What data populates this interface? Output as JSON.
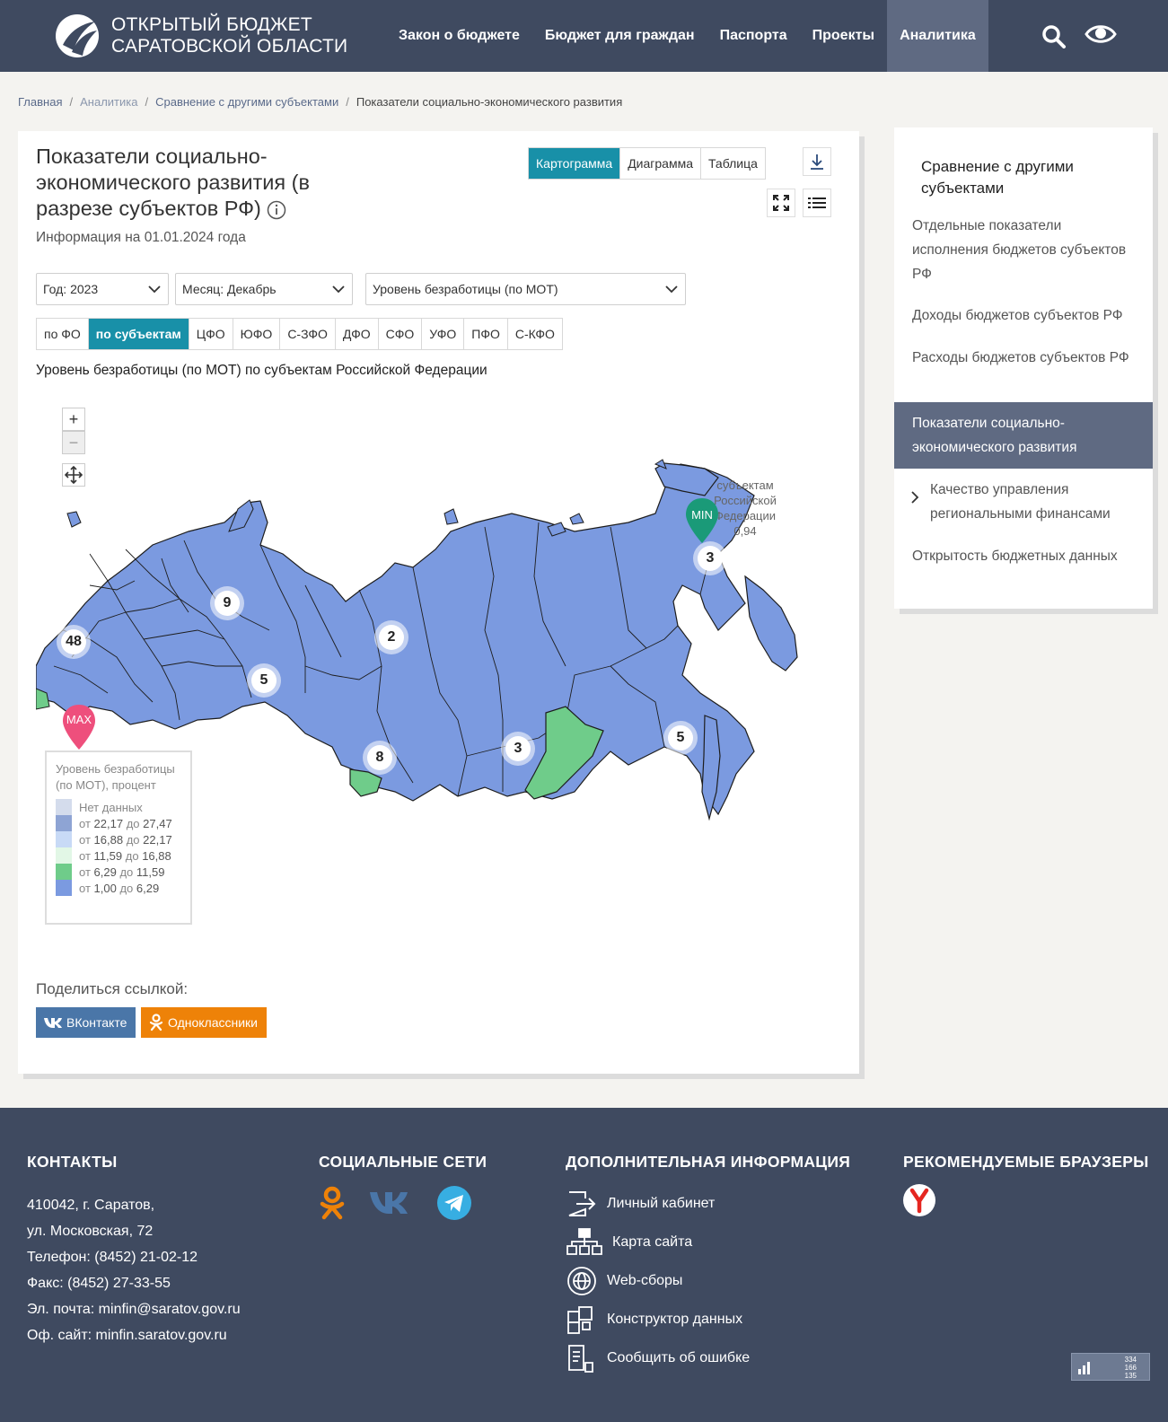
{
  "header": {
    "logo_line1": "ОТКРЫТЫЙ БЮДЖЕТ",
    "logo_line2": "САРАТОВСКОЙ ОБЛАСТИ",
    "nav": [
      {
        "label": "Закон о бюджете"
      },
      {
        "label": "Бюджет для граждан"
      },
      {
        "label": "Паспорта"
      },
      {
        "label": "Проекты"
      },
      {
        "label": "Аналитика"
      }
    ]
  },
  "breadcrumb": {
    "home": "Главная",
    "analytics": "Аналитика",
    "compare": "Сравнение с другими субъектами",
    "current": "Показатели социально-экономического развития"
  },
  "card": {
    "title": "Показатели социально-экономического развития (в разрезе субъектов РФ)",
    "subtitle": "Информация на 01.01.2024 года",
    "view_tabs": [
      "Картограмма",
      "Диаграмма",
      "Таблица"
    ],
    "selects": {
      "year": "Год: 2023",
      "month": "Месяц: Декабрь",
      "indicator": "Уровень безработицы (по МОТ)"
    },
    "region_tabs": [
      "по ФО",
      "по субъектам",
      "ЦФО",
      "ЮФО",
      "С-ЗФО",
      "ДФО",
      "СФО",
      "УФО",
      "ПФО",
      "С-КФО"
    ],
    "map_title": "Уровень безработицы (по МОТ) по субъектам Российской Федерации",
    "zoom_in": "+",
    "zoom_out": "−",
    "clusters": [
      "9",
      "48",
      "2",
      "5",
      "8",
      "3",
      "3",
      "5"
    ],
    "min_label": "MIN",
    "max_label": "MAX",
    "min_tooltip": [
      "субъектам",
      "Российской",
      "Федерации",
      "0,94"
    ],
    "legend": {
      "title": "Уровень безработицы (по МОТ), процент",
      "no_data": "Нет данных",
      "from_word": "от",
      "to_word": "до",
      "ranges": [
        {
          "from": "22,17",
          "to": "27,47"
        },
        {
          "from": "16,88",
          "to": "22,17"
        },
        {
          "from": "11,59",
          "to": "16,88"
        },
        {
          "from": "6,29",
          "to": "11,59"
        },
        {
          "from": "1,00",
          "to": "6,29"
        }
      ]
    },
    "share_label": "Поделиться ссылкой:",
    "share_vk": "ВКонтакте",
    "share_ok": "Одноклассники"
  },
  "sidebar": {
    "title": "Сравнение с другими субъектами",
    "items": [
      {
        "label": "Отдельные показатели исполнения бюджетов субъектов РФ"
      },
      {
        "label": "Доходы бюджетов субъектов РФ"
      },
      {
        "label": "Расходы бюджетов субъектов РФ"
      },
      {
        "label": "Показатели социально-экономического развития"
      },
      {
        "label": "Качество управления региональными финансами"
      },
      {
        "label": "Открытость бюджетных данных"
      }
    ]
  },
  "footer": {
    "contacts_title": "КОНТАКТЫ",
    "contacts": [
      "410042, г. Саратов,",
      "ул. Московская, 72",
      "Телефон: (8452) 21-02-12",
      "Факс: (8452) 27-33-55",
      "Эл. почта: minfin@saratov.gov.ru",
      "Оф. сайт: minfin.saratov.gov.ru"
    ],
    "social_title": "СОЦИАЛЬНЫЕ СЕТИ",
    "extra_title": "ДОПОЛНИТЕЛЬНАЯ ИНФОРМАЦИЯ",
    "extra_links": [
      "Личный кабинет",
      "Карта сайта",
      "Web-сборы",
      "Конструктор данных",
      "Сообщить об ошибке"
    ],
    "browsers_title": "РЕКОМЕНДУЕМЫЕ БРАУЗЕРЫ",
    "counter": [
      "334",
      "166",
      "135"
    ]
  },
  "colors": {
    "header_bg": "#3f4a60",
    "accent": "#1890a8",
    "map_fill": "#7b9ae0",
    "map_green": "#6fcc8a",
    "min_marker": "#1a9a78",
    "max_marker": "#ee4f7c",
    "vk": "#4a76a8",
    "ok": "#ee8208"
  }
}
